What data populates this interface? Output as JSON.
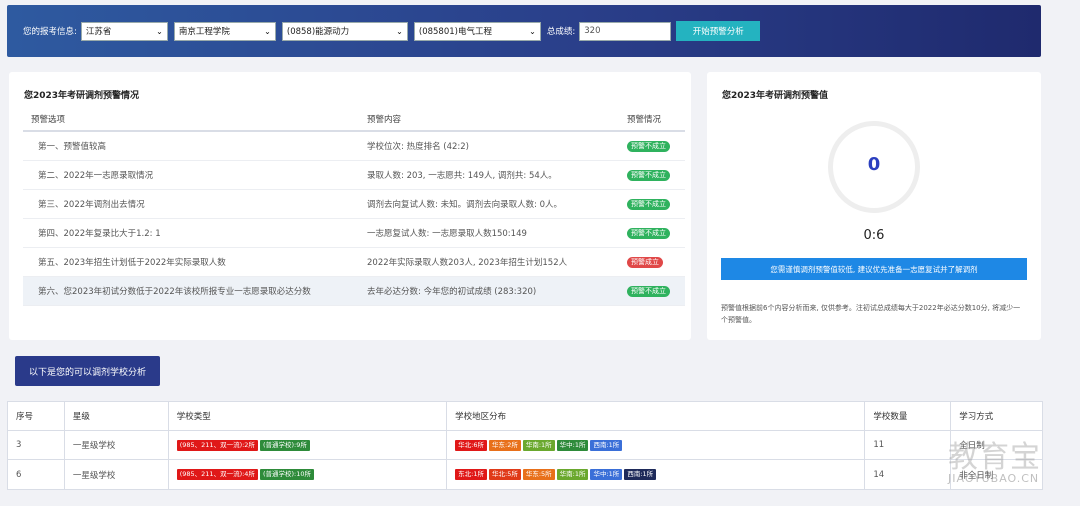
{
  "filter": {
    "label": "您的报考信息:",
    "province": "江苏省",
    "school": "南京工程学院",
    "major": "(0858)能源动力",
    "direction": "(085801)电气工程",
    "score_label": "总成绩:",
    "score_value": "320",
    "start_button": "开始预警分析"
  },
  "warning": {
    "title": "您2023年考研调剂预警情况",
    "headers": [
      "预警选项",
      "预警内容",
      "预警情况"
    ],
    "rows": [
      {
        "option": "第一、预警值较高",
        "content": "学校位次: 热度排名 (42:2)",
        "status": "预警不成立",
        "status_type": "ok"
      },
      {
        "option": "第二、2022年一志愿录取情况",
        "content": "录取人数: 203, 一志愿共: 149人, 调剂共: 54人。",
        "status": "预警不成立",
        "status_type": "ok"
      },
      {
        "option": "第三、2022年调剂出去情况",
        "content": "调剂去向复试人数: 未知。调剂去向录取人数: 0人。",
        "status": "预警不成立",
        "status_type": "ok"
      },
      {
        "option": "第四、2022年复录比大于1.2: 1",
        "content": "一志愿复试人数: 一志愿录取人数150:149",
        "status": "预警不成立",
        "status_type": "ok"
      },
      {
        "option": "第五、2023年招生计划低于2022年实际录取人数",
        "content": "2022年实际录取人数203人, 2023年招生计划152人",
        "status": "预警成立",
        "status_type": "alert"
      },
      {
        "option": "第六、您2023年初试分数低于2022年该校所报专业一志愿录取必达分数",
        "content": "去年必达分数: 今年您的初试成绩 (283:320)",
        "status": "预警不成立",
        "status_type": "ok"
      }
    ]
  },
  "value_panel": {
    "title": "您2023年考研调剂预警值",
    "value": "0",
    "ratio": "0:6",
    "advice": "您需谨慎调剂预警值较低, 建议优先准备一志愿复试并了解调剂",
    "note": "预警值根据前6个内容分析而来, 仅供参考。注初试总成绩每大于2022年必达分数10分, 将减少一个预警值。"
  },
  "section_button": "以下是您的可以调剂学校分析",
  "school_table": {
    "headers": [
      "序号",
      "星级",
      "学校类型",
      "学校地区分布",
      "学校数量",
      "学习方式"
    ],
    "rows": [
      {
        "index": "3",
        "star": "一星级学校",
        "types": [
          {
            "text": "(985、211、双一流):2所",
            "color": "#e01818"
          },
          {
            "text": "(普通学校):9所",
            "color": "#2e8b3a"
          }
        ],
        "regions": [
          {
            "text": "华北:6所",
            "color": "#e01818"
          },
          {
            "text": "华东:2所",
            "color": "#e8701a"
          },
          {
            "text": "华南:1所",
            "color": "#6aa82e"
          },
          {
            "text": "华中:1所",
            "color": "#2e8b3a"
          },
          {
            "text": "西南:1所",
            "color": "#3a6fd8"
          }
        ],
        "count": "11",
        "mode": "全日制"
      },
      {
        "index": "6",
        "star": "一星级学校",
        "types": [
          {
            "text": "(985、211、双一流):4所",
            "color": "#e01818"
          },
          {
            "text": "(普通学校):10所",
            "color": "#2e8b3a"
          }
        ],
        "regions": [
          {
            "text": "东北:1所",
            "color": "#e01818"
          },
          {
            "text": "华北:5所",
            "color": "#e03a18"
          },
          {
            "text": "华东:5所",
            "color": "#e8701a"
          },
          {
            "text": "华南:1所",
            "color": "#6aa82e"
          },
          {
            "text": "华中:1所",
            "color": "#3a6fd8"
          },
          {
            "text": "西南:1所",
            "color": "#1e2a5a"
          }
        ],
        "count": "14",
        "mode": "非全日制"
      }
    ]
  },
  "watermark": {
    "big": "教育宝",
    "small": "JIAOYUBAO.CN"
  }
}
